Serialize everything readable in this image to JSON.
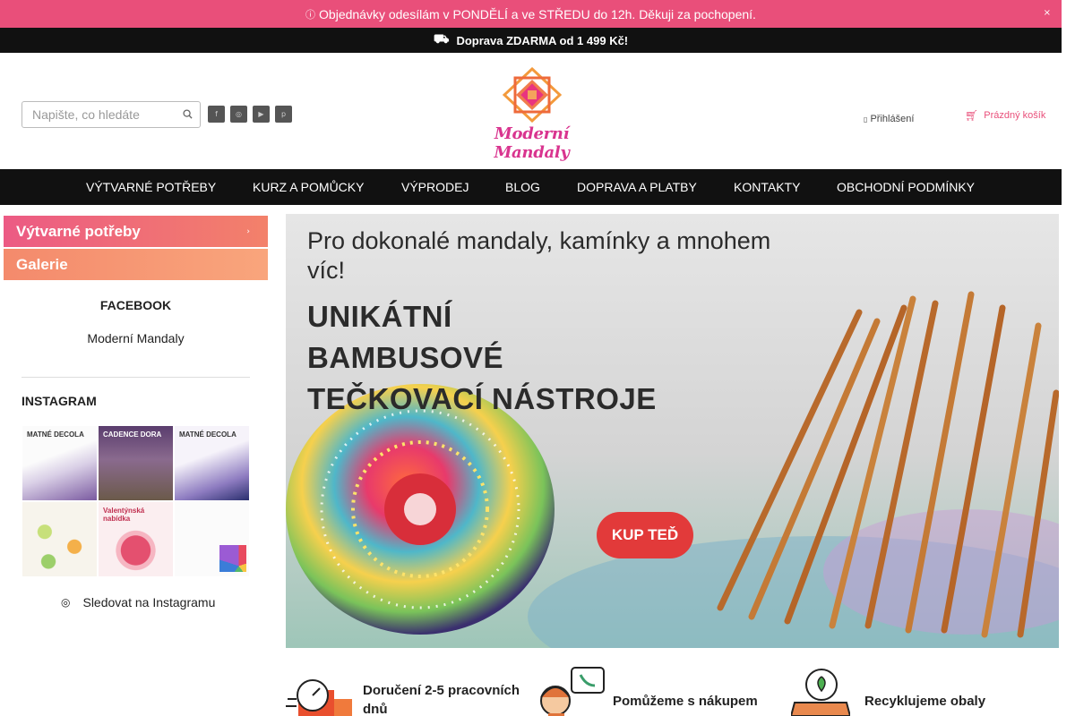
{
  "notice": {
    "text": "Objednávky odesílám v PONDĚLÍ a ve STŘEDU do 12h. Děkuji za pochopení.",
    "close": "×"
  },
  "shipping": {
    "text": "Doprava ZDARMA od 1 499 Kč!"
  },
  "search": {
    "placeholder": "Napište, co hledáte",
    "value": ""
  },
  "socials": [
    "facebook-icon",
    "instagram-icon",
    "youtube-icon",
    "pinterest-icon"
  ],
  "logo": {
    "text": "Moderní Mandaly"
  },
  "header": {
    "login": "Přihlášení",
    "cart": "Prázdný košík"
  },
  "nav": [
    "VÝTVARNÉ POTŘEBY",
    "KURZ A POMŮCKY",
    "VÝPRODEJ",
    "BLOG",
    "DOPRAVA A PLATBY",
    "KONTAKTY",
    "OBCHODNÍ PODMÍNKY"
  ],
  "sidebar": {
    "categories": [
      "Výtvarné potřeby",
      "Galerie"
    ],
    "facebook_title": "FACEBOOK",
    "facebook_link": "Moderní Mandaly",
    "instagram_title": "INSTAGRAM",
    "instagram_tiles": [
      "MATNÉ DECOLA",
      "CADENCE DORA",
      "MATNÉ DECOLA",
      "",
      "Valentýnská nabídka",
      ""
    ],
    "instagram_follow": "Sledovat na Instagramu"
  },
  "banner": {
    "title": "Pro dokonalé mandaly, kamínky a mnohem víc!",
    "headline": [
      "UNIKÁTNÍ",
      "BAMBUSOVÉ",
      "TEČKOVACÍ NÁSTROJE"
    ],
    "cta": "KUP TEĎ"
  },
  "features": [
    "Doručení 2-5 pracovních dnů",
    "Pomůžeme s nákupem",
    "Recyklujeme obaly"
  ],
  "colors": {
    "accent": "#e94f7a",
    "dark": "#111111",
    "cta": "#e23a3a"
  }
}
